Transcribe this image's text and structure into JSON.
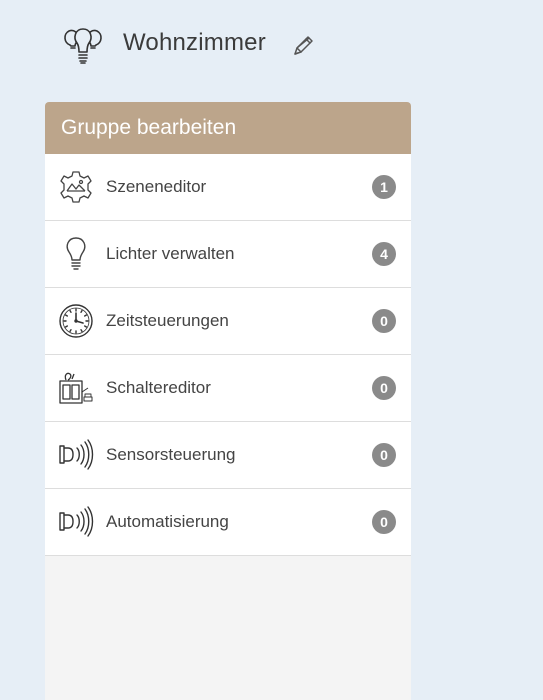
{
  "header": {
    "title": "Wohnzimmer",
    "room_icon": "light-bulbs-group-icon",
    "edit_icon": "pencil-icon"
  },
  "panel": {
    "title": "Gruppe bearbeiten",
    "items": [
      {
        "label": "Szeneneditor",
        "count": "1",
        "icon": "scene-gear-icon"
      },
      {
        "label": "Lichter verwalten",
        "count": "4",
        "icon": "light-bulb-icon"
      },
      {
        "label": "Zeitsteuerungen",
        "count": "0",
        "icon": "clock-icon"
      },
      {
        "label": "Schaltereditor",
        "count": "0",
        "icon": "switch-icon"
      },
      {
        "label": "Sensorsteuerung",
        "count": "0",
        "icon": "sensor-icon"
      },
      {
        "label": "Automatisierung",
        "count": "0",
        "icon": "automation-sensor-icon"
      }
    ]
  },
  "colors": {
    "page_background": "#e6eef6",
    "panel_header": "#bca58b",
    "badge": "#8a8a8a",
    "panel_body": "#f4f4f4"
  }
}
